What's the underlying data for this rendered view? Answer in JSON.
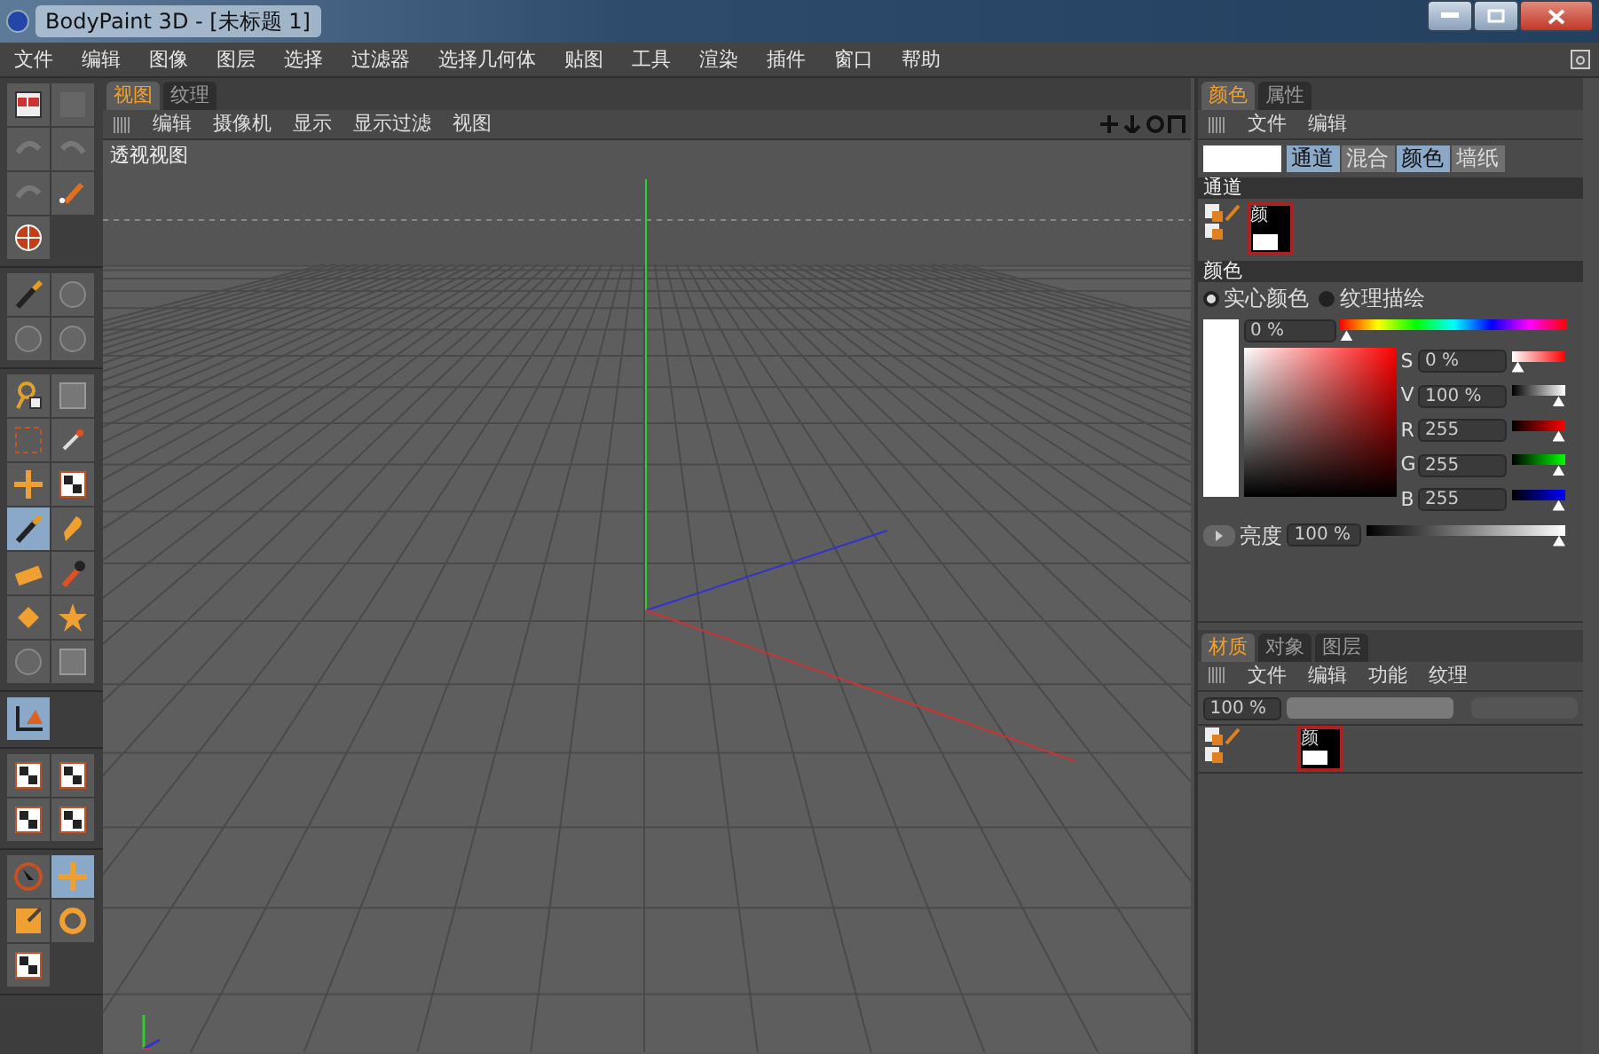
{
  "window": {
    "title": "BodyPaint 3D - [未标题 1]"
  },
  "menu": [
    "文件",
    "编辑",
    "图像",
    "图层",
    "选择",
    "过滤器",
    "选择几何体",
    "贴图",
    "工具",
    "渲染",
    "插件",
    "窗口",
    "帮助"
  ],
  "toolbar": [
    {
      "tools": [
        {
          "kind": "layout",
          "selected": false
        },
        {
          "kind": "blank",
          "selected": false
        },
        {
          "kind": "undo",
          "selected": false
        },
        {
          "kind": "redo",
          "selected": false
        },
        {
          "kind": "undo",
          "selected": false
        },
        {
          "kind": "paint",
          "selected": false
        },
        {
          "kind": "globe",
          "selected": false
        }
      ]
    },
    {
      "tools": [
        {
          "kind": "brush",
          "selected": false
        },
        {
          "kind": "disc",
          "selected": false
        },
        {
          "kind": "disc",
          "selected": false
        },
        {
          "kind": "disc",
          "selected": false
        }
      ]
    },
    {
      "tools": [
        {
          "kind": "lasso",
          "selected": false
        },
        {
          "kind": "frame",
          "selected": false
        },
        {
          "kind": "select",
          "selected": false
        },
        {
          "kind": "wand",
          "selected": false
        },
        {
          "kind": "move",
          "selected": false
        },
        {
          "kind": "checker",
          "selected": false
        },
        {
          "kind": "brush",
          "selected": true
        },
        {
          "kind": "smudge",
          "selected": false
        },
        {
          "kind": "eraser",
          "selected": false
        },
        {
          "kind": "dropper",
          "selected": false
        },
        {
          "kind": "bucket",
          "selected": false
        },
        {
          "kind": "star",
          "selected": false
        },
        {
          "kind": "disc",
          "selected": false
        },
        {
          "kind": "frame",
          "selected": false
        }
      ]
    },
    {
      "tools": [
        {
          "kind": "axis",
          "selected": true
        }
      ]
    },
    {
      "tools": [
        {
          "kind": "checker",
          "selected": false
        },
        {
          "kind": "checker",
          "selected": false
        },
        {
          "kind": "checker",
          "selected": false
        },
        {
          "kind": "checker",
          "selected": false
        }
      ]
    },
    {
      "tools": [
        {
          "kind": "pointer",
          "selected": false
        },
        {
          "kind": "move",
          "selected": true
        },
        {
          "kind": "scale",
          "selected": false
        },
        {
          "kind": "rotate",
          "selected": false
        },
        {
          "kind": "checker",
          "selected": false
        }
      ]
    }
  ],
  "viewport": {
    "tabs": [
      {
        "label": "视图",
        "selected": true
      },
      {
        "label": "纹理",
        "selected": false
      }
    ],
    "menu": [
      "编辑",
      "摄像机",
      "显示",
      "显示过滤",
      "视图"
    ],
    "label": "透视视图"
  },
  "color_panel": {
    "tabs": [
      {
        "label": "颜色",
        "selected": true
      },
      {
        "label": "属性",
        "selected": false
      }
    ],
    "menu": [
      "文件",
      "编辑"
    ],
    "modes": [
      {
        "label": "通道",
        "selected": true
      },
      {
        "label": "混合",
        "selected": false
      },
      {
        "label": "颜色",
        "selected": true
      },
      {
        "label": "墙纸",
        "selected": false
      }
    ],
    "channel_header": "通道",
    "swatch_label": "颜",
    "color_header": "颜色",
    "radios": [
      {
        "label": "实心颜色",
        "selected": true
      },
      {
        "label": "纹理描绘",
        "selected": false
      }
    ],
    "hue": {
      "value": "0 %",
      "level": 0
    },
    "sliders": [
      {
        "label": "S",
        "value": "0 %",
        "level": 0,
        "kind": "sat"
      },
      {
        "label": "V",
        "value": "100 %",
        "level": 1,
        "kind": "val"
      },
      {
        "label": "R",
        "value": "255",
        "level": 1,
        "kind": "red"
      },
      {
        "label": "G",
        "value": "255",
        "level": 1,
        "kind": "green"
      },
      {
        "label": "B",
        "value": "255",
        "level": 1,
        "kind": "blue"
      }
    ],
    "brightness": {
      "label": "亮度",
      "value": "100 %",
      "level": 1
    }
  },
  "material_panel": {
    "tabs": [
      {
        "label": "材质",
        "selected": true
      },
      {
        "label": "对象",
        "selected": false
      },
      {
        "label": "图层",
        "selected": false
      }
    ],
    "menu": [
      "文件",
      "编辑",
      "功能",
      "纹理"
    ],
    "zoom_value": "100 %",
    "zoom_slider": {
      "level": 1
    },
    "swatch_label": "颜"
  }
}
